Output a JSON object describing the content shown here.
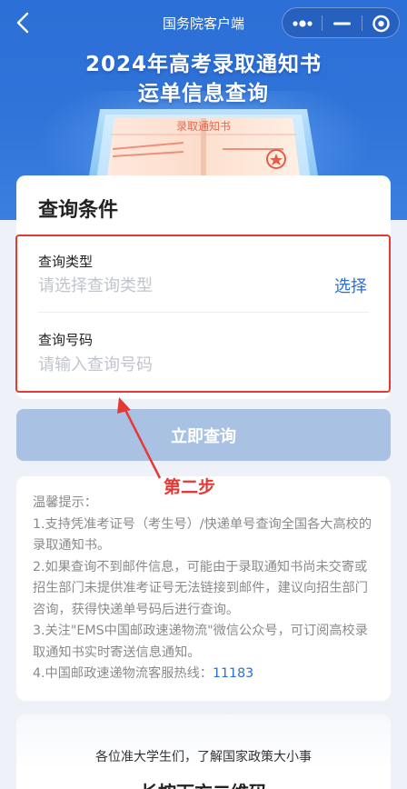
{
  "navbar": {
    "title": "国务院客户端",
    "back_icon": "chevron-left-icon",
    "more_icon": "more-dots-icon",
    "minimize_icon": "minus-icon",
    "close_icon": "target-circle-icon"
  },
  "hero": {
    "title_line1": "2024年高考录取通知书",
    "title_line2": "运单信息查询",
    "illustration_label": "录取通知书"
  },
  "query_card": {
    "title": "查询条件",
    "type_field": {
      "label": "查询类型",
      "placeholder": "请选择查询类型",
      "action_label": "选择"
    },
    "number_field": {
      "label": "查询号码",
      "placeholder": "请输入查询号码"
    }
  },
  "submit_button": {
    "label": "立即查询"
  },
  "annotation": {
    "step_label": "第二步",
    "color": "#e53935"
  },
  "tips": {
    "heading": "温馨提示：",
    "items": [
      "1.支持凭准考证号（考生号）/快递单号查询全国各大高校的录取通知书。",
      "2.如果查询不到邮件信息，可能由于录取通知书尚未交寄或招生部门未提供准考证号无法链接到邮件，建议向招生部门咨询，获得快递单号码后进行查询。",
      "3.关注\"EMS中国邮政速递物流\"微信公众号，可订阅高校录取通知书实时寄送信息通知。",
      "4.中国邮政速递物流客服热线："
    ],
    "hotline": "11183"
  },
  "news_card": {
    "text": "各位准大学生们，了解国家政策大小事",
    "partial_title": "长按下方二维码"
  },
  "colors": {
    "brand_blue": "#2c6fd6",
    "button_disabled": "#a9c2e4",
    "highlight_red": "#e53935"
  }
}
